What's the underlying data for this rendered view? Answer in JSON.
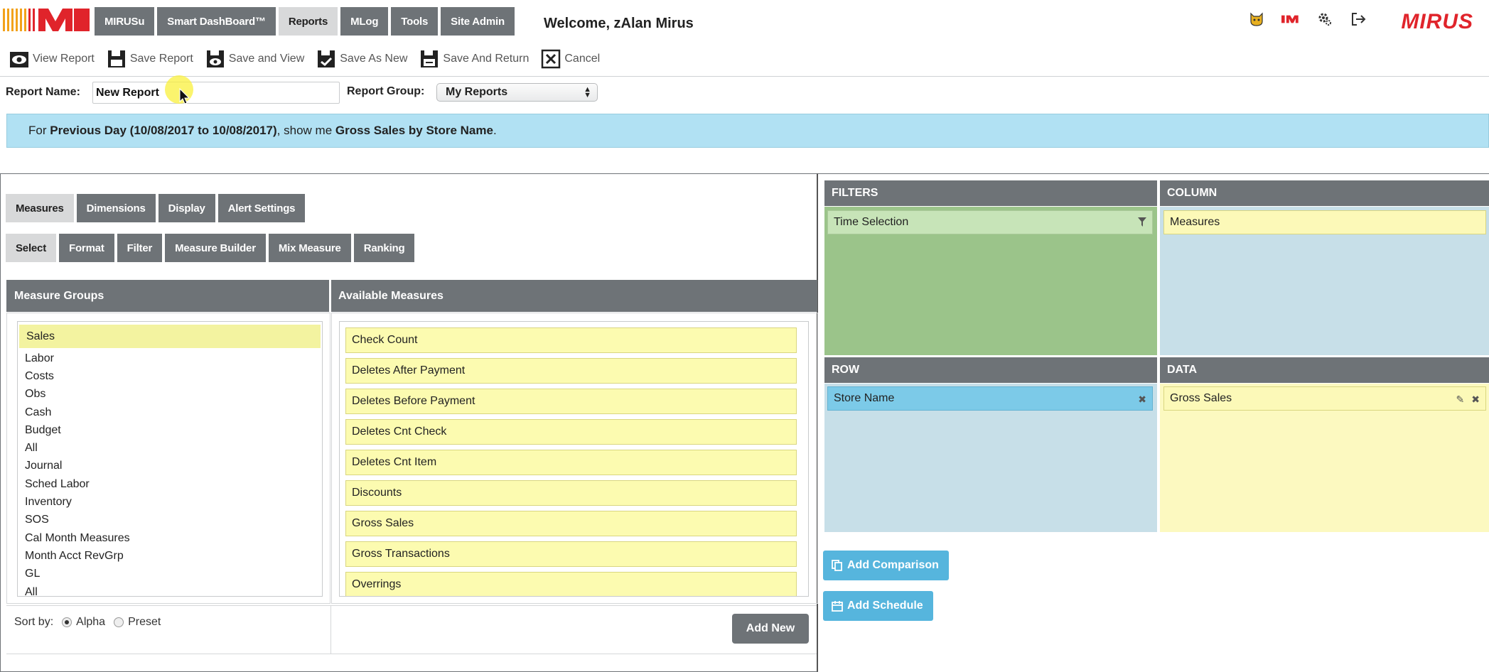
{
  "nav": {
    "tabs": [
      {
        "label": "MIRUSu",
        "active": false
      },
      {
        "label": "Smart DashBoard™",
        "active": false
      },
      {
        "label": "Reports",
        "active": true
      },
      {
        "label": "MLog",
        "active": false
      },
      {
        "label": "Tools",
        "active": false
      },
      {
        "label": "Site Admin",
        "active": false
      }
    ],
    "welcome": "Welcome, zAlan Mirus",
    "icons": [
      "cat-icon",
      "im-logo-icon",
      "gear-icon",
      "logout-icon"
    ],
    "brand": "MIRUS"
  },
  "toolbar": {
    "view_report": "View Report",
    "save_report": "Save Report",
    "save_and_view": "Save and View",
    "save_as_new": "Save As New",
    "save_and_return": "Save And Return",
    "cancel": "Cancel"
  },
  "report": {
    "name_label": "Report Name:",
    "name_value": "New Report",
    "group_label": "Report Group:",
    "group_value": "My Reports"
  },
  "summary": {
    "prefix": "For ",
    "period": "Previous Day (10/08/2017 to 10/08/2017)",
    "middle": ", show me ",
    "subject": "Gross Sales by Store Name",
    "suffix": "."
  },
  "tabs_primary": [
    {
      "label": "Measures",
      "active": true
    },
    {
      "label": "Dimensions",
      "active": false
    },
    {
      "label": "Display",
      "active": false
    },
    {
      "label": "Alert Settings",
      "active": false
    }
  ],
  "tabs_secondary": [
    {
      "label": "Select",
      "active": true
    },
    {
      "label": "Format",
      "active": false
    },
    {
      "label": "Filter",
      "active": false
    },
    {
      "label": "Measure Builder",
      "active": false
    },
    {
      "label": "Mix Measure",
      "active": false
    },
    {
      "label": "Ranking",
      "active": false
    }
  ],
  "measure_groups": {
    "header": "Measure Groups",
    "selected": "Sales",
    "items": [
      "Labor",
      "Costs",
      "Obs",
      "Cash",
      "Budget",
      "All",
      "Journal",
      "Sched Labor",
      "Inventory",
      "SOS",
      "Cal Month Measures",
      "Month Acct RevGrp",
      "GL",
      "All"
    ]
  },
  "available_measures": {
    "header": "Available Measures",
    "items": [
      "Check Count",
      "Deletes After Payment",
      "Deletes Before Payment",
      "Deletes Cnt Check",
      "Deletes Cnt Item",
      "Discounts",
      "Gross Sales",
      "Gross Transactions",
      "Overrings"
    ]
  },
  "sort": {
    "label": "Sort by:",
    "alpha": "Alpha",
    "preset": "Preset",
    "selected": "Alpha"
  },
  "add_new": "Add New",
  "zones": {
    "filters": {
      "header": "FILTERS",
      "chip": "Time Selection"
    },
    "column": {
      "header": "COLUMN",
      "chip": "Measures"
    },
    "row": {
      "header": "ROW",
      "chip": "Store Name"
    },
    "data": {
      "header": "DATA",
      "chip": "Gross Sales"
    }
  },
  "buttons": {
    "add_comparison": "Add Comparison",
    "add_schedule": "Add Schedule"
  },
  "colors": {
    "tab_gray": "#6e7377",
    "summary_blue": "#b1e1f3",
    "filters_green": "#9bc48a",
    "row_blue": "#c7dfe8",
    "data_yellow": "#fcf9c0",
    "chip_yellow": "#fcfbb0",
    "button_blue": "#56b5dd",
    "brand_red": "#e0242b"
  }
}
